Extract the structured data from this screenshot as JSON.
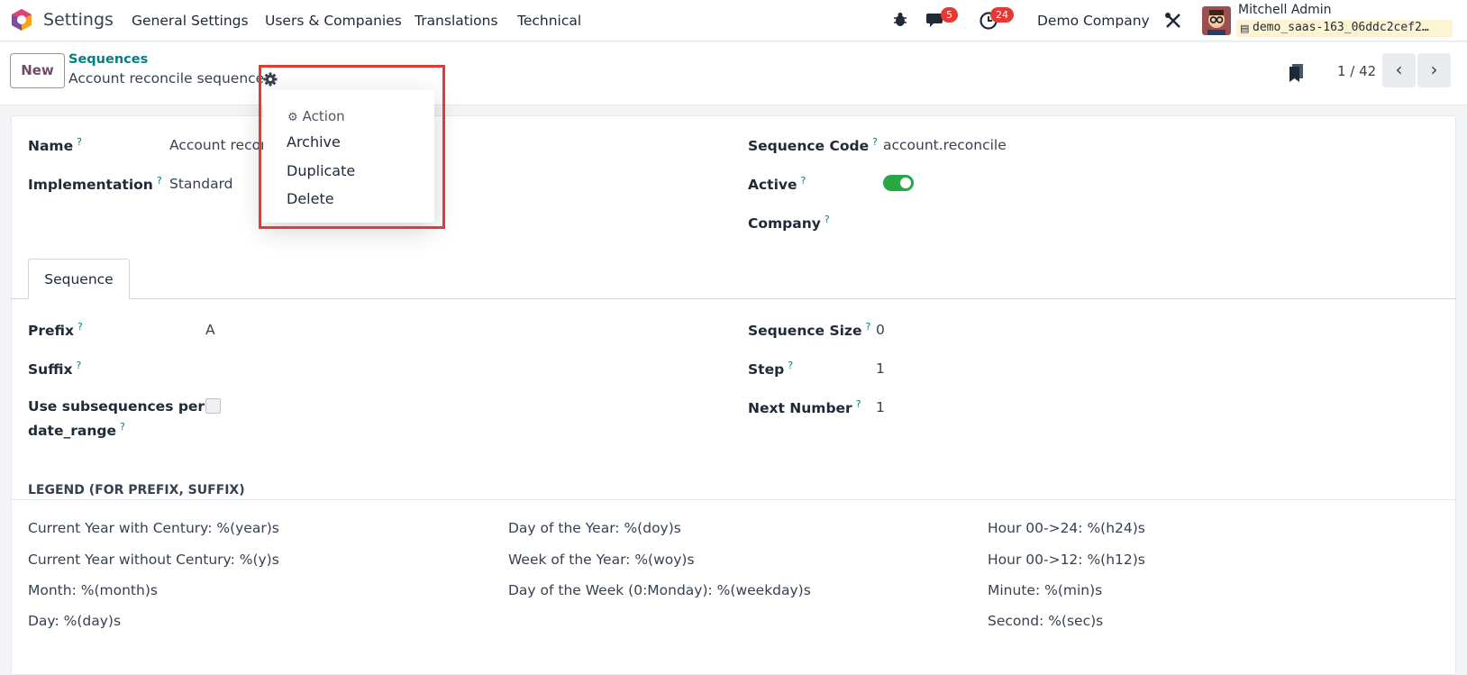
{
  "navbar": {
    "app_name": "Settings",
    "menus": [
      "General Settings",
      "Users & Companies",
      "Translations",
      "Technical"
    ],
    "messages_count": "5",
    "activities_count": "24",
    "company": "Demo Company",
    "user_name": "Mitchell Admin",
    "database": "demo_saas-163_06ddc2cef2…"
  },
  "control": {
    "new_label": "New",
    "breadcrumb_parent": "Sequences",
    "breadcrumb_current": "Account reconcile sequence",
    "pager": "1 / 42"
  },
  "action_menu": {
    "header": "Action",
    "items": [
      "Archive",
      "Duplicate",
      "Delete"
    ]
  },
  "form": {
    "name_label": "Name",
    "name_value": "Account recon",
    "implementation_label": "Implementation",
    "implementation_value": "Standard",
    "code_label": "Sequence Code",
    "code_value": "account.reconcile",
    "active_label": "Active",
    "active_value": true,
    "company_label": "Company"
  },
  "tabs": [
    "Sequence"
  ],
  "sequence_tab": {
    "prefix_label": "Prefix",
    "prefix_value": "A",
    "suffix_label": "Suffix",
    "subseq_label_1": "Use subsequences per",
    "subseq_label_2": "date_range",
    "size_label": "Sequence Size",
    "size_value": "0",
    "step_label": "Step",
    "step_value": "1",
    "next_label": "Next Number",
    "next_value": "1"
  },
  "legend": {
    "title": "LEGEND (FOR PREFIX, SUFFIX)",
    "col1": [
      "Current Year with Century: %(year)s",
      "Current Year without Century: %(y)s",
      "Month: %(month)s",
      "Day: %(day)s"
    ],
    "col2": [
      "Day of the Year: %(doy)s",
      "Week of the Year: %(woy)s",
      "Day of the Week (0:Monday): %(weekday)s"
    ],
    "col3": [
      "Hour 00->24: %(h24)s",
      "Hour 00->12: %(h12)s",
      "Minute: %(min)s",
      "Second: %(sec)s"
    ]
  },
  "colors": {
    "brand": "#714b67",
    "link": "#017e84",
    "toggle_on": "#28a745",
    "highlight": "#e53935"
  }
}
